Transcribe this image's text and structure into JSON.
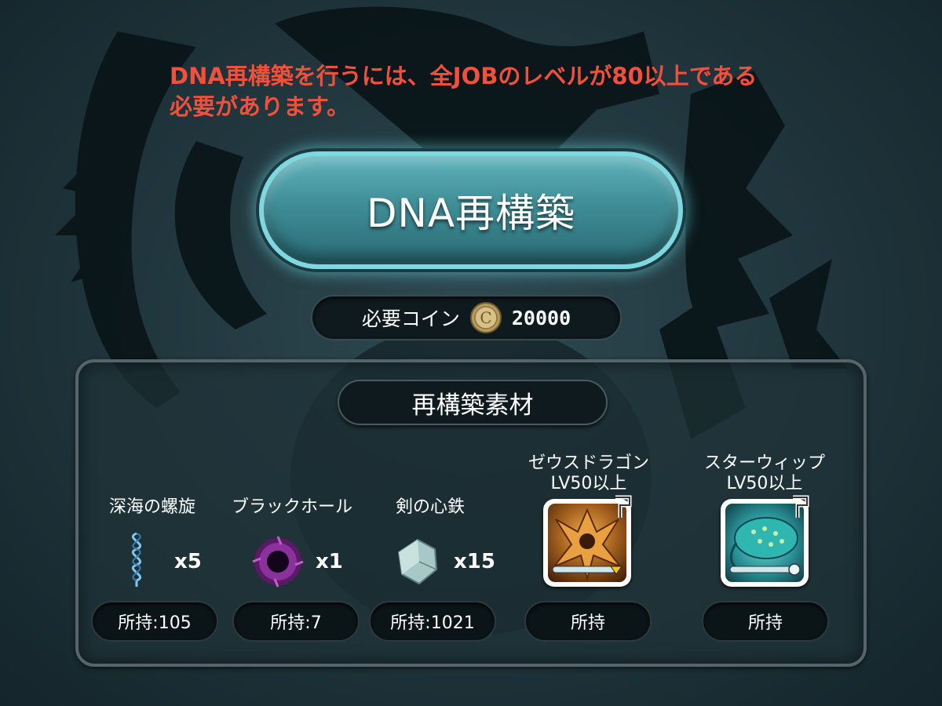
{
  "warning_text": "DNA再構築を行うには、全JOBのレベルが80以上である必要があります。",
  "dna_button_label": "DNA再構築",
  "cost": {
    "label": "必要コイン",
    "value": "20000",
    "icon": "coin-icon"
  },
  "materials_panel": {
    "title": "再構築素材",
    "items": [
      {
        "name": "深海の螺旋",
        "quantity": "x5",
        "owned": "所持:105",
        "icon": "spiral-icon"
      },
      {
        "name": "ブラックホール",
        "quantity": "x1",
        "owned": "所持:7",
        "icon": "black-hole-icon"
      },
      {
        "name": "剣の心鉄",
        "quantity": "x15",
        "owned": "所持:1021",
        "icon": "crystal-icon"
      },
      {
        "name": "ゼウスドラゴン",
        "requirement": "LV50以上",
        "owned": "所持",
        "icon": "zeus-dragon-portrait"
      },
      {
        "name": "スターウィップ",
        "requirement": "LV50以上",
        "owned": "所持",
        "icon": "star-whip-portrait"
      }
    ]
  },
  "colors": {
    "warning": "#f0503c",
    "button_accent": "#7fd8e0"
  }
}
